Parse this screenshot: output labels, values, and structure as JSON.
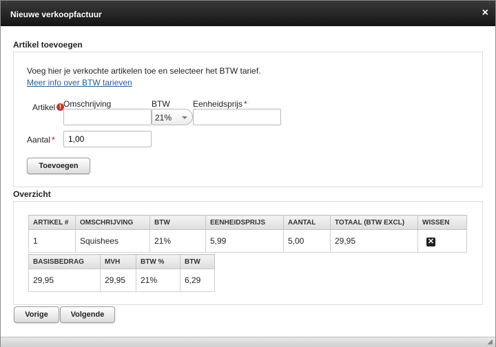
{
  "dialog": {
    "title": "Nieuwe verkoopfactuur",
    "close_glyph": "×"
  },
  "add_article": {
    "section_title": "Artikel toevoegen",
    "intro_text": "Voeg hier je verkochte artikelen toe en selecteer het BTW tarief.",
    "info_link": "Meer info over BTW tarieven",
    "article_label": "Artikel",
    "description_label": "Omschrijving",
    "description_value": "",
    "btw_label": "BTW",
    "btw_selected": "21%",
    "unit_price_label": "Eenheidsprijs",
    "unit_price_value": "",
    "required_mark": "*",
    "quantity_label": "Aantal",
    "quantity_value": "1,00",
    "add_button": "Toevoegen"
  },
  "overview": {
    "section_title": "Overzicht",
    "items_table": {
      "headers": [
        "ARTIKEL #",
        "OMSCHRIJVING",
        "BTW",
        "EENHEIDSPRIJS",
        "AANTAL",
        "TOTAAL (BTW EXCL)",
        "WISSEN"
      ],
      "rows": [
        [
          "1",
          "Squishees",
          "21%",
          "5,99",
          "5,00",
          "29,95"
        ]
      ]
    },
    "totals_table": {
      "headers": [
        "BASISBEDRAG",
        "MVH",
        "BTW %",
        "BTW"
      ],
      "rows": [
        [
          "29,95",
          "29,95",
          "21%",
          "6,29"
        ]
      ]
    }
  },
  "nav": {
    "previous_button": "Vorige",
    "next_button": "Volgende"
  },
  "icons": {
    "error": "error-icon",
    "delete": "delete-icon",
    "resize": "resize-grip-icon"
  }
}
